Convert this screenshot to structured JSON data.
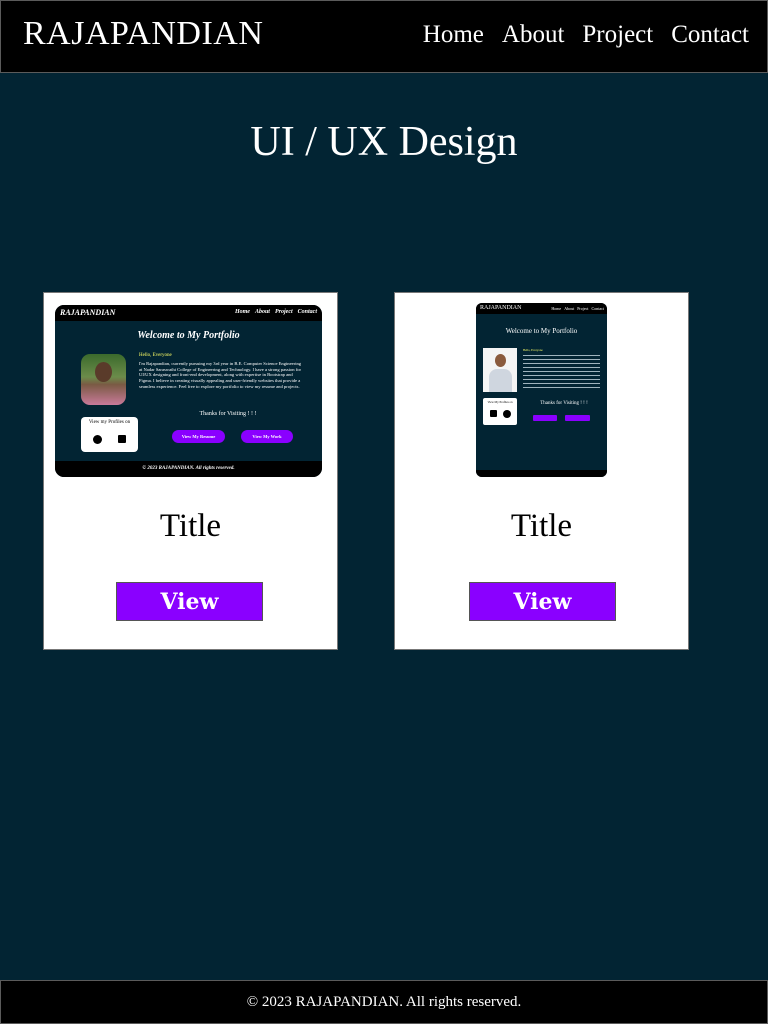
{
  "header": {
    "brand": "RAJAPANDIAN",
    "nav": [
      "Home",
      "About",
      "Project",
      "Contact"
    ]
  },
  "page": {
    "title": "UI / UX Design"
  },
  "cards": [
    {
      "title": "Title",
      "button": "View",
      "thumbnail": {
        "brand": "RAJAPANDIAN",
        "nav": [
          "Home",
          "About",
          "Project",
          "Contact"
        ],
        "heading": "Welcome to My Portfolio",
        "hello": "Hello, Everyone",
        "bio": "I'm Rajapandian, currently pursuing my 3rd year in B.E. Computer Science Engineering at Nadar Saraswathi College of Engineering and Technology. I have a strong passion for UI/UX designing and front-end development, along with expertise in Bootstrap and Figma. I believe in creating visually appealing and user-friendly websites that provide a seamless experience. Feel free to explore my portfolio to view my resume and projects.",
        "profiles_label": "View my Profiles on",
        "thanks": "Thanks for Visiting ! ! !",
        "btn_resume": "View My Resume",
        "btn_work": "View My Work",
        "footer": "© 2023 RAJAPANDIAN. All rights reserved."
      }
    },
    {
      "title": "Title",
      "button": "View",
      "thumbnail": {
        "brand": "RAJAPANDIAN",
        "nav": [
          "Home",
          "About",
          "Project",
          "Contact"
        ],
        "heading": "Welcome to My Portfolio",
        "hello": "Hello, Everyone",
        "profiles_label": "View My Profiles on",
        "thanks": "Thanks for Visiting ! ! !"
      }
    }
  ],
  "footer": {
    "text": "© 2023 RAJAPANDIAN. All rights reserved."
  },
  "colors": {
    "background": "#022433",
    "bar": "#000000",
    "accent": "#8a00ff",
    "hello": "#ffff66"
  }
}
